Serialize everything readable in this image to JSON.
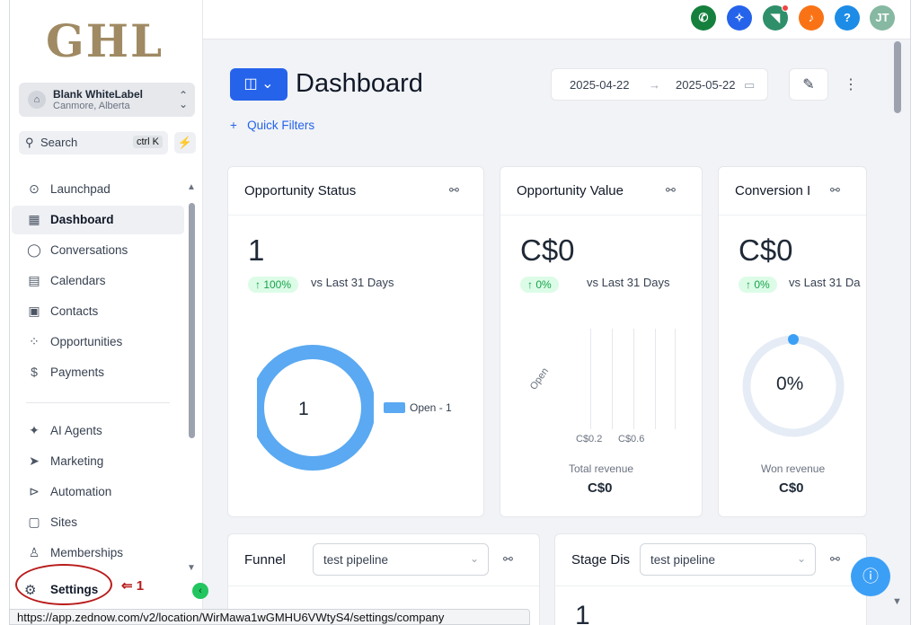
{
  "sidebar": {
    "logo": "GHL",
    "account": {
      "name": "Blank WhiteLabel",
      "location": "Canmore, Alberta"
    },
    "search": {
      "placeholder": "Search",
      "shortcut": "ctrl K"
    },
    "items": [
      {
        "label": "Launchpad",
        "icon": "rocket-icon",
        "glyph": "⊙"
      },
      {
        "label": "Dashboard",
        "icon": "grid-icon",
        "glyph": "▦",
        "active": true
      },
      {
        "label": "Conversations",
        "icon": "chat-icon",
        "glyph": "◯"
      },
      {
        "label": "Calendars",
        "icon": "calendar-icon",
        "glyph": "▤"
      },
      {
        "label": "Contacts",
        "icon": "contacts-icon",
        "glyph": "▣"
      },
      {
        "label": "Opportunities",
        "icon": "opportunities-icon",
        "glyph": "⁘"
      },
      {
        "label": "Payments",
        "icon": "payments-icon",
        "glyph": "$"
      },
      {
        "label": "AI Agents",
        "icon": "sparkle-icon",
        "glyph": "✦"
      },
      {
        "label": "Marketing",
        "icon": "send-icon",
        "glyph": "➤"
      },
      {
        "label": "Automation",
        "icon": "automation-icon",
        "glyph": "⊳"
      },
      {
        "label": "Sites",
        "icon": "sites-icon",
        "glyph": "▢"
      },
      {
        "label": "Memberships",
        "icon": "membership-icon",
        "glyph": "♙"
      }
    ],
    "settings": {
      "label": "Settings",
      "icon": "gear-icon",
      "glyph": "⚙"
    },
    "annotation_number": "1"
  },
  "topbar": {
    "buttons": [
      {
        "name": "phone-button",
        "icon": "phone-icon",
        "glyph": "✆",
        "color": "#15803d"
      },
      {
        "name": "launch-button",
        "icon": "magic-wand-icon",
        "glyph": "✧",
        "color": "#2563eb"
      },
      {
        "name": "announcements-button",
        "icon": "megaphone-icon",
        "glyph": "◥",
        "color": "#2f8f6a"
      },
      {
        "name": "notifications-button",
        "icon": "bell-icon",
        "glyph": "♪",
        "color": "#f97316"
      },
      {
        "name": "help-button",
        "icon": "question-icon",
        "glyph": "?",
        "color": "#1d8ce6"
      },
      {
        "name": "user-avatar",
        "icon": "avatar",
        "glyph": "JT",
        "color": "#86b8a2"
      }
    ]
  },
  "header": {
    "title": "Dashboard",
    "date_start": "2025-04-22",
    "date_end": "2025-05-22",
    "quick_filters": "Quick Filters"
  },
  "cards": {
    "opportunity_status": {
      "title": "Opportunity Status",
      "value": "1",
      "change": "↑ 100%",
      "vs": "vs Last 31 Days",
      "donut_center": "1",
      "legend": "Open - 1"
    },
    "opportunity_value": {
      "title": "Opportunity Value",
      "value": "C$0",
      "change": "↑ 0%",
      "vs": "vs Last 31 Days",
      "axis_category": "Open",
      "tick_1": "C$0.2",
      "tick_2": "C$0.6",
      "footer_label": "Total revenue",
      "footer_value": "C$0"
    },
    "conversion": {
      "title": "Conversion I",
      "value": "C$0",
      "change": "↑ 0%",
      "vs": "vs Last 31 Da",
      "gauge": "0%",
      "footer_label": "Won revenue",
      "footer_value": "C$0"
    },
    "funnel": {
      "title": "Funnel",
      "pipeline": "test pipeline"
    },
    "stage_distribution": {
      "title": "Stage Dis",
      "pipeline": "test pipeline",
      "partial_value": "1"
    }
  },
  "statusbar": {
    "url": "https://app.zednow.com/v2/location/WirMawa1wGMHU6VWtyS4/settings/company"
  }
}
